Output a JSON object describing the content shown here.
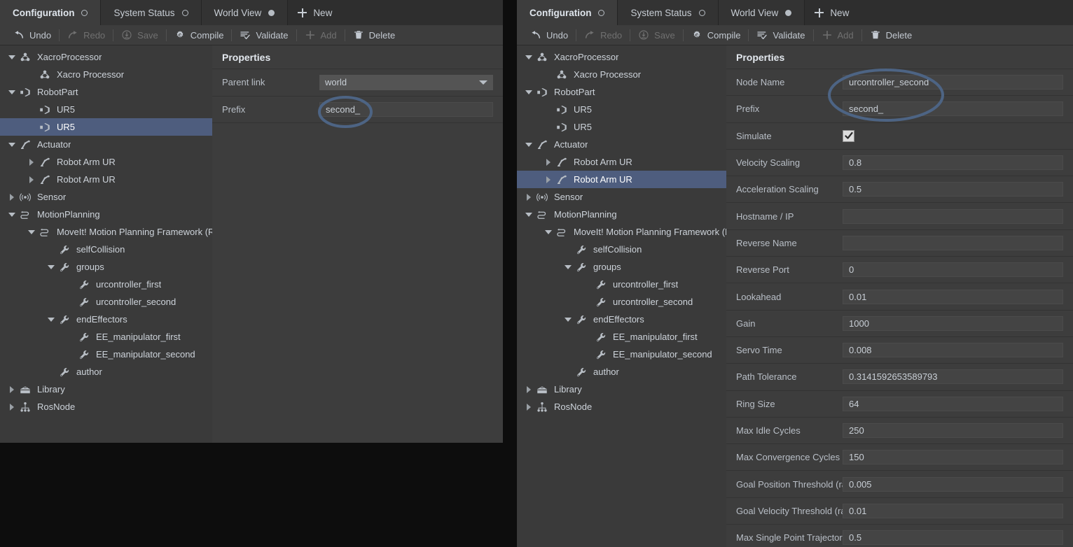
{
  "theme": {
    "window_bg": "#3a3a3a",
    "panel_bg": "#3d3d3d",
    "selection_blue": "#4e5d7e",
    "annotation_stroke": "#4d6484",
    "text": "#cdd3da"
  },
  "tabs": [
    {
      "label": "Configuration",
      "indicator": "circle-hollow-icon",
      "active": true
    },
    {
      "label": "System Status",
      "indicator": "circle-hollow-icon",
      "active": false
    },
    {
      "label": "World View",
      "indicator": "circle-filled-icon",
      "active": false
    }
  ],
  "new_tab": {
    "label": "New",
    "icon": "plus-icon"
  },
  "toolbar": [
    {
      "label": "Undo",
      "icon": "undo-arrow-icon",
      "disabled": false
    },
    {
      "label": "Redo",
      "icon": "redo-arrow-icon",
      "disabled": true
    },
    {
      "label": "Save",
      "icon": "save-download-icon",
      "disabled": true
    },
    {
      "label": "Compile",
      "icon": "gear-play-icon",
      "disabled": false
    },
    {
      "label": "Validate",
      "icon": "checklist-icon",
      "disabled": false
    },
    {
      "label": "Add",
      "icon": "plus-icon",
      "disabled": true
    },
    {
      "label": "Delete",
      "icon": "trash-icon",
      "disabled": false
    }
  ],
  "properties_title": "Properties",
  "left_window": {
    "tree": [
      {
        "label": "XacroProcessor",
        "icon": "xacro-icon",
        "indent": 0,
        "twisty": "down",
        "selected": false
      },
      {
        "label": "Xacro Processor",
        "icon": "xacro-icon",
        "indent": 1,
        "twisty": "none",
        "selected": false
      },
      {
        "label": "RobotPart",
        "icon": "robotpart-icon",
        "indent": 0,
        "twisty": "down",
        "selected": false
      },
      {
        "label": "UR5",
        "icon": "robotpart-icon",
        "indent": 1,
        "twisty": "none",
        "selected": false
      },
      {
        "label": "UR5",
        "icon": "robotpart-icon",
        "indent": 1,
        "twisty": "none",
        "selected": true
      },
      {
        "label": "Actuator",
        "icon": "robotarm-icon",
        "indent": 0,
        "twisty": "down",
        "selected": false
      },
      {
        "label": "Robot Arm UR",
        "icon": "robotarm-icon",
        "indent": 1,
        "twisty": "right",
        "selected": false
      },
      {
        "label": "Robot Arm UR",
        "icon": "robotarm-icon",
        "indent": 1,
        "twisty": "right",
        "selected": false
      },
      {
        "label": "Sensor",
        "icon": "sensor-icon",
        "indent": 0,
        "twisty": "right",
        "selected": false
      },
      {
        "label": "MotionPlanning",
        "icon": "motionplan-icon",
        "indent": 0,
        "twisty": "down",
        "selected": false
      },
      {
        "label": "MoveIt! Motion Planning Framework (RO",
        "icon": "motionplan-icon",
        "indent": 1,
        "twisty": "down",
        "selected": false
      },
      {
        "label": "selfCollision",
        "icon": "wrench-icon",
        "indent": 2,
        "twisty": "none",
        "selected": false
      },
      {
        "label": "groups",
        "icon": "wrench-icon",
        "indent": 2,
        "twisty": "down",
        "selected": false
      },
      {
        "label": "urcontroller_first",
        "icon": "wrench-icon",
        "indent": 3,
        "twisty": "none",
        "selected": false
      },
      {
        "label": "urcontroller_second",
        "icon": "wrench-icon",
        "indent": 3,
        "twisty": "none",
        "selected": false
      },
      {
        "label": "endEffectors",
        "icon": "wrench-icon",
        "indent": 2,
        "twisty": "down",
        "selected": false
      },
      {
        "label": "EE_manipulator_first",
        "icon": "wrench-icon",
        "indent": 3,
        "twisty": "none",
        "selected": false
      },
      {
        "label": "EE_manipulator_second",
        "icon": "wrench-icon",
        "indent": 3,
        "twisty": "none",
        "selected": false
      },
      {
        "label": "author",
        "icon": "wrench-icon",
        "indent": 2,
        "twisty": "none",
        "selected": false
      },
      {
        "label": "Library",
        "icon": "library-icon",
        "indent": 0,
        "twisty": "right",
        "selected": false
      },
      {
        "label": "RosNode",
        "icon": "rosnode-icon",
        "indent": 0,
        "twisty": "right",
        "selected": false
      }
    ],
    "properties": [
      {
        "label": "Parent link",
        "value": "world",
        "type": "combo"
      },
      {
        "label": "Prefix",
        "value": "second_",
        "type": "text"
      }
    ]
  },
  "right_window": {
    "tree": [
      {
        "label": "XacroProcessor",
        "icon": "xacro-icon",
        "indent": 0,
        "twisty": "down",
        "selected": false
      },
      {
        "label": "Xacro Processor",
        "icon": "xacro-icon",
        "indent": 1,
        "twisty": "none",
        "selected": false
      },
      {
        "label": "RobotPart",
        "icon": "robotpart-icon",
        "indent": 0,
        "twisty": "down",
        "selected": false
      },
      {
        "label": "UR5",
        "icon": "robotpart-icon",
        "indent": 1,
        "twisty": "none",
        "selected": false
      },
      {
        "label": "UR5",
        "icon": "robotpart-icon",
        "indent": 1,
        "twisty": "none",
        "selected": false
      },
      {
        "label": "Actuator",
        "icon": "robotarm-icon",
        "indent": 0,
        "twisty": "down",
        "selected": false
      },
      {
        "label": "Robot Arm UR",
        "icon": "robotarm-icon",
        "indent": 1,
        "twisty": "right",
        "selected": false
      },
      {
        "label": "Robot Arm UR",
        "icon": "robotarm-icon",
        "indent": 1,
        "twisty": "right",
        "selected": true
      },
      {
        "label": "Sensor",
        "icon": "sensor-icon",
        "indent": 0,
        "twisty": "right",
        "selected": false
      },
      {
        "label": "MotionPlanning",
        "icon": "motionplan-icon",
        "indent": 0,
        "twisty": "down",
        "selected": false
      },
      {
        "label": "MoveIt! Motion Planning Framework (RO",
        "icon": "motionplan-icon",
        "indent": 1,
        "twisty": "down",
        "selected": false
      },
      {
        "label": "selfCollision",
        "icon": "wrench-icon",
        "indent": 2,
        "twisty": "none",
        "selected": false
      },
      {
        "label": "groups",
        "icon": "wrench-icon",
        "indent": 2,
        "twisty": "down",
        "selected": false
      },
      {
        "label": "urcontroller_first",
        "icon": "wrench-icon",
        "indent": 3,
        "twisty": "none",
        "selected": false
      },
      {
        "label": "urcontroller_second",
        "icon": "wrench-icon",
        "indent": 3,
        "twisty": "none",
        "selected": false
      },
      {
        "label": "endEffectors",
        "icon": "wrench-icon",
        "indent": 2,
        "twisty": "down",
        "selected": false
      },
      {
        "label": "EE_manipulator_first",
        "icon": "wrench-icon",
        "indent": 3,
        "twisty": "none",
        "selected": false
      },
      {
        "label": "EE_manipulator_second",
        "icon": "wrench-icon",
        "indent": 3,
        "twisty": "none",
        "selected": false
      },
      {
        "label": "author",
        "icon": "wrench-icon",
        "indent": 2,
        "twisty": "none",
        "selected": false
      },
      {
        "label": "Library",
        "icon": "library-icon",
        "indent": 0,
        "twisty": "right",
        "selected": false
      },
      {
        "label": "RosNode",
        "icon": "rosnode-icon",
        "indent": 0,
        "twisty": "right",
        "selected": false
      }
    ],
    "properties": [
      {
        "label": "Node Name",
        "value": "urcontroller_second",
        "type": "text"
      },
      {
        "label": "Prefix",
        "value": "second_",
        "type": "text"
      },
      {
        "label": "Simulate",
        "value": "",
        "type": "checkbox",
        "checked": true
      },
      {
        "label": "Velocity Scaling",
        "value": "0.8",
        "type": "text"
      },
      {
        "label": "Acceleration Scaling",
        "value": "0.5",
        "type": "text"
      },
      {
        "label": "Hostname / IP",
        "value": "",
        "type": "text"
      },
      {
        "label": "Reverse Name",
        "value": "",
        "type": "text"
      },
      {
        "label": "Reverse Port",
        "value": "0",
        "type": "text"
      },
      {
        "label": "Lookahead",
        "value": "0.01",
        "type": "text"
      },
      {
        "label": "Gain",
        "value": "1000",
        "type": "text"
      },
      {
        "label": "Servo Time",
        "value": "0.008",
        "type": "text"
      },
      {
        "label": "Path Tolerance",
        "value": "0.3141592653589793",
        "type": "text"
      },
      {
        "label": "Ring Size",
        "value": "64",
        "type": "text"
      },
      {
        "label": "Max Idle Cycles",
        "value": "250",
        "type": "text"
      },
      {
        "label": "Max Convergence Cycles",
        "value": "150",
        "type": "text"
      },
      {
        "label": "Goal Position Threshold (ra",
        "value": "0.005",
        "type": "text"
      },
      {
        "label": "Goal Velocity Threshold (ra",
        "value": "0.01",
        "type": "text"
      },
      {
        "label": "Max Single Point Trajector",
        "value": "0.5",
        "type": "text"
      }
    ]
  }
}
